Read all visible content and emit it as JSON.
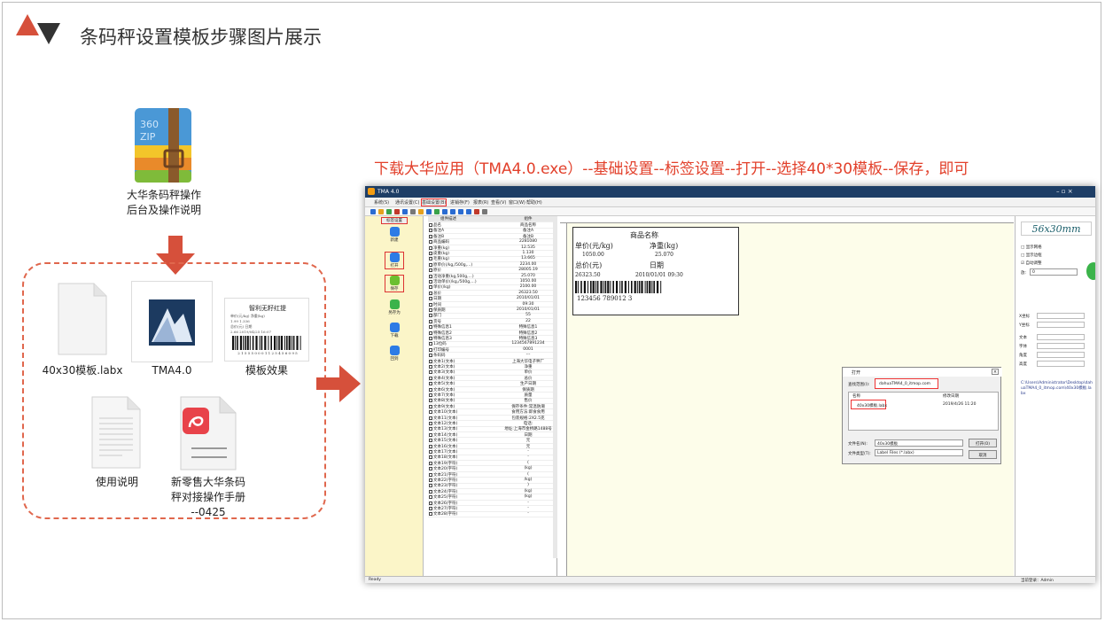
{
  "header": {
    "title": "条码秤设置模板步骤图片展示"
  },
  "package": {
    "label_line1": "大华条码秤操作",
    "label_line2": "后台及操作说明",
    "icon_text_1": "360",
    "icon_text_2": "ZIP"
  },
  "files": [
    {
      "name": "40x30模板.labx"
    },
    {
      "name": "TMA4.0"
    },
    {
      "name": "模板效果"
    },
    {
      "name": "使用说明"
    },
    {
      "name_line1": "新零售大华条码",
      "name_line2": "秤对接操作手册",
      "name_line3": "--0425"
    }
  ],
  "preview_label": {
    "shop": "智利无籽红提",
    "row1": "单价(元/kg)  净重(kg)",
    "row2": "1.99        1.336",
    "row3": "总价(元)    日期",
    "row4": "2.66   2019/04/25 16:07",
    "code": "2 1 5 5 5 0 0 0 1 1 2 5 4 5 6 0 9 5"
  },
  "caption": "下载大华应用（TMA4.0.exe）--基础设置--标签设置--打开--选择40*30模板--保存，即可",
  "app": {
    "window_title": "TMA 4.0",
    "menu": [
      "系统(S)",
      "通讯设置(C)",
      "基础设置(B)",
      "进销存(F)",
      "报表(R)",
      "查看(V)",
      "窗口(W)",
      "帮助(H)"
    ],
    "left_header": "标签设置",
    "left_buttons": [
      "新建",
      "打开",
      "保存",
      "另存为",
      "下载",
      "回到"
    ],
    "grid_header": [
      "组件描述",
      "组件"
    ],
    "grid_rows": [
      [
        "品名",
        "商品名称"
      ],
      [
        "备注A",
        "备注A"
      ],
      [
        "备注B",
        "备注B"
      ],
      [
        "商品编码",
        "2281080"
      ],
      [
        "净重(kg)",
        "12.535"
      ],
      [
        "皮重(kg)",
        "1.130"
      ],
      [
        "毛重(kg)",
        "13.665"
      ],
      [
        "原单价(/kg,/500g,...)",
        "2234.00"
      ],
      [
        "原价",
        "28005.19"
      ],
      [
        "活动净重(kg,500g,...)",
        "25.070"
      ],
      [
        "活动单价(/kg,/500g,...)",
        "1050.00"
      ],
      [
        "单价(/kg)",
        "2100.00"
      ],
      [
        "总价",
        "26323.50"
      ],
      [
        "日期",
        "2010/01/01"
      ],
      [
        "时间",
        "09:30"
      ],
      [
        "保质期",
        "2010/01/01"
      ],
      [
        "部门",
        "55"
      ],
      [
        "货号",
        "22"
      ],
      [
        "特殊信息1",
        "特殊信息1"
      ],
      [
        "特殊信息2",
        "特殊信息2"
      ],
      [
        "特殊信息3",
        "特殊信息3"
      ],
      [
        "13位码",
        "1234567891234"
      ],
      [
        "打印编号",
        "0001"
      ],
      [
        "条码码",
        "---"
      ],
      [
        "文本1(文本)",
        "上海大华电子秤厂"
      ],
      [
        "文本2(文本)",
        "净重"
      ],
      [
        "文本3(文本)",
        "单价"
      ],
      [
        "文本4(文本)",
        "总价"
      ],
      [
        "文本5(文本)",
        "生产日期"
      ],
      [
        "文本6(文本)",
        "保质期"
      ],
      [
        "文本7(文本)",
        "质量"
      ],
      [
        "文本8(文本)",
        "售价"
      ],
      [
        "文本9(文本)",
        "保存条件:常温防潮"
      ],
      [
        "文本10(文本)",
        "食用方法:即食食用"
      ],
      [
        "文本11(文本)",
        "包装规格:2X2.5克"
      ],
      [
        "文本12(文本)",
        "电话:"
      ],
      [
        "文本13(文本)",
        "地址:上海市金桥路1488号"
      ],
      [
        "文本14(文本)",
        "日期"
      ],
      [
        "文本15(文本)",
        "元"
      ],
      [
        "文本16(文本)",
        "元"
      ],
      [
        "文本17(文本)",
        "-"
      ],
      [
        "文本18(文本)",
        "-"
      ],
      [
        "文本19(字符)",
        "("
      ],
      [
        "文本20(字符)",
        "(kg)"
      ],
      [
        "文本21(字符)",
        "("
      ],
      [
        "文本22(字符)",
        "/kg)"
      ],
      [
        "文本23(字符)",
        ")"
      ],
      [
        "文本24(字符)",
        "(kg)"
      ],
      [
        "文本25(字符)",
        "(kg)"
      ],
      [
        "文本26(字符)",
        "-"
      ],
      [
        "文本27(字符)",
        "-"
      ],
      [
        "文本28(字符)",
        "-"
      ]
    ],
    "label": {
      "name": "商品名称",
      "unit_price_label": "单价(元/kg)",
      "net_weight_label": "净重(kg)",
      "unit_price": "1050.00",
      "net_weight": "25.070",
      "total_label": "总价(元)",
      "date_label": "日期",
      "total": "26323.50",
      "date_time": "2010/01/01  09:30",
      "barcode_digits": "123456 789012 3"
    },
    "dialog": {
      "title": "打开",
      "lookin_label": "查找范围(I):",
      "lookin_value": "dahuaTMA4_0_itmop.com",
      "col_name": "名称",
      "col_date": "修改日期",
      "file_name": "40x30模板.labx",
      "file_date": "2019/4/26 11:20",
      "filename_label": "文件名(N):",
      "filename_value": "40x30模板",
      "filetype_label": "文件类型(T):",
      "filetype_value": "Label Files (*.labx)",
      "open_button": "打开(O)",
      "cancel_button": "取消"
    },
    "right_panel": {
      "size_title": "56x30mm",
      "opt1": "显示网格",
      "opt2": "显示边框",
      "opt3": "自动调整",
      "zoom_label": "放:",
      "zoom_value": "0",
      "fields": [
        "X坐标",
        "Y坐标",
        "文本",
        "字体",
        "角度",
        "高度"
      ],
      "path": "C:\\Users\\Administrator\\Desktop\\dahuaTMA4_0_itmop.com\\40x30模板.labx",
      "status_user": "当前登录：Admin"
    },
    "status": "Ready"
  }
}
